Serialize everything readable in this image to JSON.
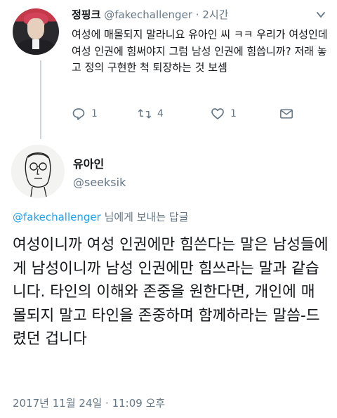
{
  "parent_tweet": {
    "name": "정핑크",
    "handle": "@fakechallenger",
    "separator": "·",
    "time": "2시간",
    "text": "여성에 매몰되지 말라니요 유아인 씨 ㅋㅋ 우리가 여성인데 여성 인권에 힘써야지 그럼 남성 인권에 힘씁니까? 저래 놓고 정의 구현한 척 퇴장하는 것 보셈",
    "actions": {
      "reply_count": "1",
      "retweet_count": "4",
      "like_count": "1"
    }
  },
  "main_tweet": {
    "name": "유아인",
    "handle": "@seeksik",
    "replying_to_handle": "@fakechallenger",
    "replying_suffix": " 님에게 보내는 답글",
    "text": "여성이니까 여성 인권에만 힘쓴다는 말은 남성들에게 남성이니까 남성 인권에만 힘쓰라는 말과 같습니다. 타인의 이해와 존중을 원한다면, 개인에 매몰되지 말고 타인을 존중하며 함께하라는 말씀-드렸던 겁니다",
    "timestamp": "2017년 11월 24일 · 11:09 오후"
  },
  "colors": {
    "text": "#14171a",
    "secondary": "#657786",
    "link": "#1da1f2",
    "thread_line": "#cdd6dd"
  }
}
